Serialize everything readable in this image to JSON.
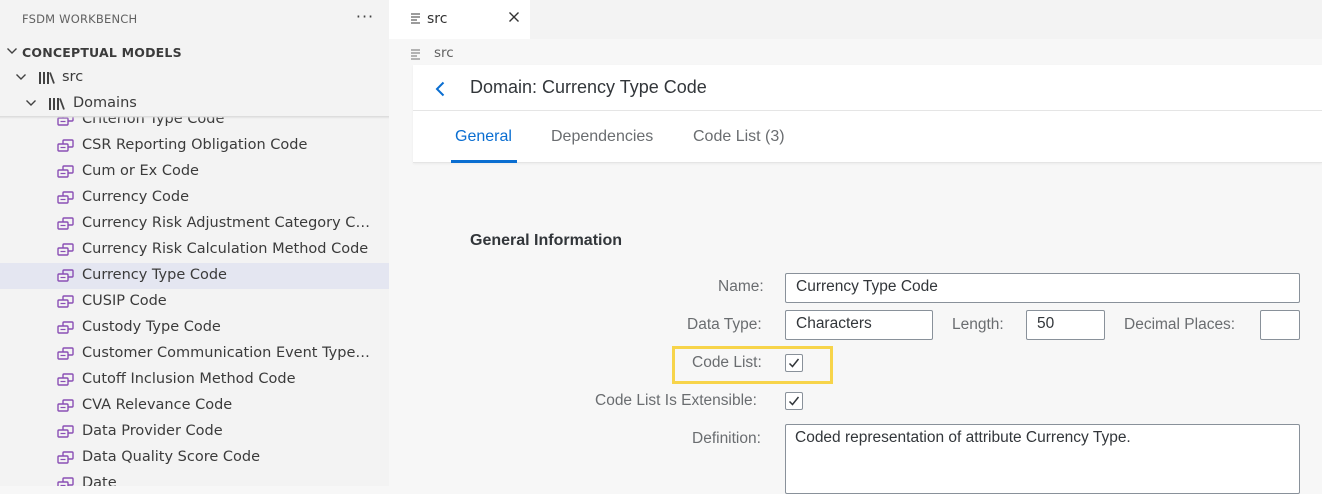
{
  "sidebar": {
    "title": "FSDM WORKBENCH",
    "more_icon": "ellipsis-icon",
    "section_label": "CONCEPTUAL MODELS",
    "root_label": "src",
    "folder_label": "Domains",
    "items": [
      {
        "label": "Criterion Type Code"
      },
      {
        "label": "CSR Reporting Obligation Code"
      },
      {
        "label": "Cum or Ex Code"
      },
      {
        "label": "Currency Code"
      },
      {
        "label": "Currency Risk Adjustment Category Code"
      },
      {
        "label": "Currency Risk Calculation Method Code"
      },
      {
        "label": "Currency Type Code",
        "selected": true
      },
      {
        "label": "CUSIP Code"
      },
      {
        "label": "Custody Type Code"
      },
      {
        "label": "Customer Communication Event Type Co..."
      },
      {
        "label": "Cutoff Inclusion Method Code"
      },
      {
        "label": "CVA Relevance Code"
      },
      {
        "label": "Data Provider Code"
      },
      {
        "label": "Data Quality Score Code"
      },
      {
        "label": "Date"
      }
    ]
  },
  "editor_tab": {
    "label": "src"
  },
  "breadcrumb": {
    "label": "src"
  },
  "page": {
    "title": "Domain: Currency Type Code",
    "tabs": [
      {
        "label": "General",
        "active": true
      },
      {
        "label": "Dependencies"
      },
      {
        "label": "Code List (3)"
      }
    ]
  },
  "general_info": {
    "section_title": "General Information",
    "name_label": "Name:",
    "name_value": "Currency Type Code",
    "data_type_label": "Data Type:",
    "data_type_value": "Characters",
    "length_label": "Length:",
    "length_value": "50",
    "decimal_places_label": "Decimal Places:",
    "decimal_places_value": "",
    "code_list_label": "Code List:",
    "code_list_checked": true,
    "code_list_extensible_label": "Code List Is Extensible:",
    "code_list_extensible_checked": true,
    "definition_label": "Definition:",
    "definition_value": "Coded representation of attribute Currency Type."
  },
  "colors": {
    "accent": "#0a6ed1",
    "highlight": "#f7d44a",
    "selection": "#e4e6f1",
    "domain_icon": "#8a4fb5"
  }
}
